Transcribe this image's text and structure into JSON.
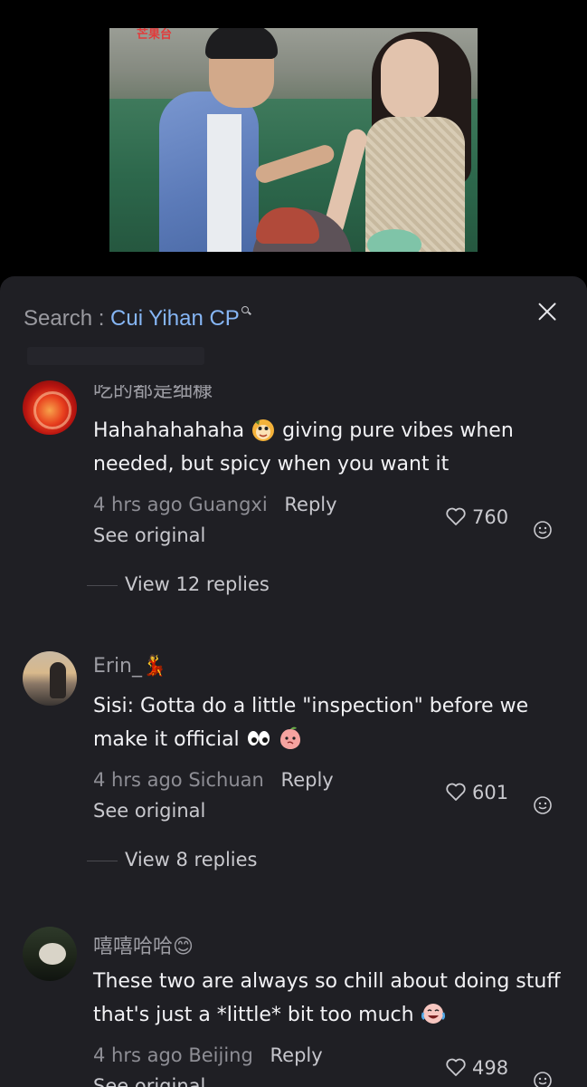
{
  "video": {
    "channel_logo": "芒果台"
  },
  "header": {
    "search_prefix": "Search : ",
    "search_term": "Cui Yihan CP"
  },
  "comments": [
    {
      "username": "吃的都是细糠",
      "text": "Hahahahahaha",
      "text_after_emoji": "giving pure vibes when needed, but spicy when you want it",
      "emoji": "monkey-face-icon",
      "time": "4 hrs ago",
      "location": "Guangxi",
      "reply_label": "Reply",
      "see_original": "See original",
      "likes": "760",
      "view_replies": "View 12 replies"
    },
    {
      "username": "Erin_💃",
      "text": "Sisi: Gotta do a little \"inspection\" before we make it official",
      "emojis": [
        "eyes-icon",
        "peach-face-icon"
      ],
      "time": "4 hrs ago",
      "location": "Sichuan",
      "reply_label": "Reply",
      "see_original": "See original",
      "likes": "601",
      "view_replies": "View 8 replies"
    },
    {
      "username": "嘻嘻哈哈😊",
      "text": "These two are always so chill about doing stuff that's just a *little* bit too much",
      "emoji": "crying-laughing-icon",
      "time": "4 hrs ago",
      "location": "Beijing",
      "reply_label": "Reply",
      "see_original": "See original",
      "likes": "498"
    }
  ],
  "colors": {
    "sheet_background": "#1f1f24",
    "search_term": "#86b6f5",
    "primary_text": "#f2f2f5",
    "secondary_text": "#8e8e95"
  }
}
